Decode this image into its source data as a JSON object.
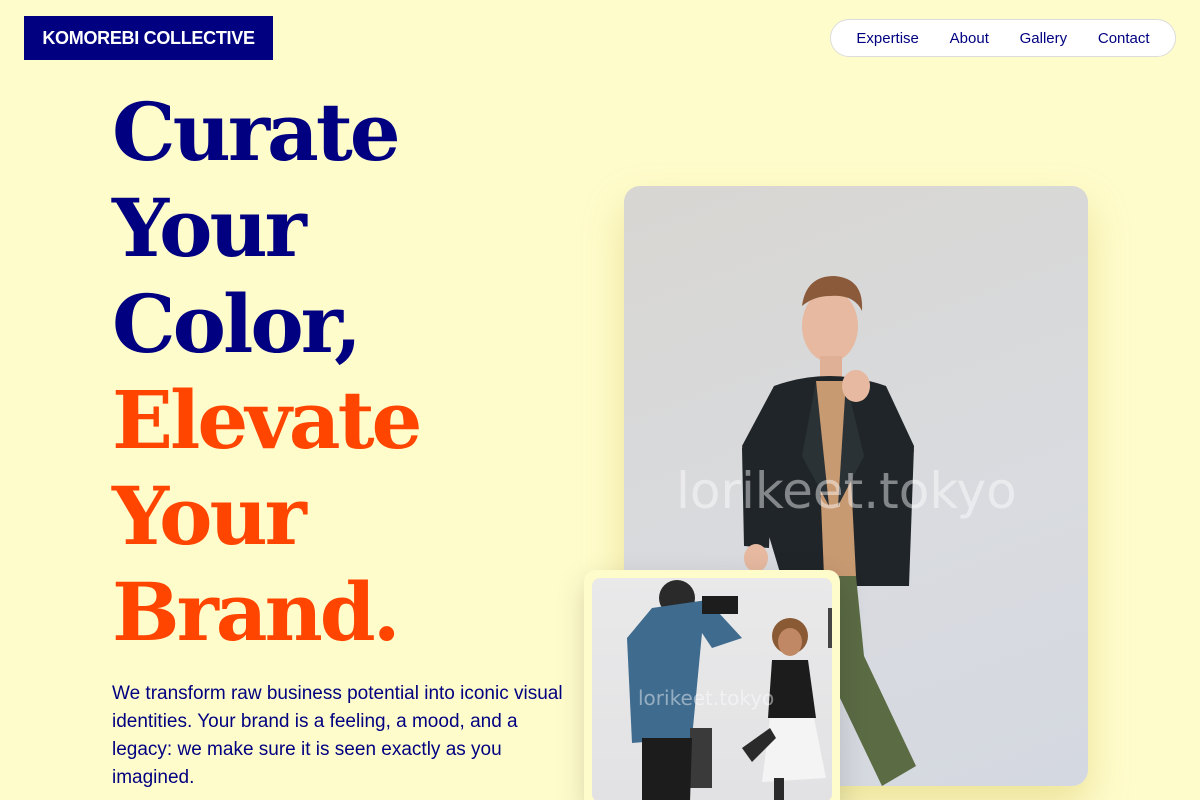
{
  "brand": {
    "name": "KOMOREBI COLLECTIVE"
  },
  "nav": {
    "items": [
      {
        "label": "Expertise"
      },
      {
        "label": "About"
      },
      {
        "label": "Gallery"
      },
      {
        "label": "Contact"
      }
    ]
  },
  "hero": {
    "headline_lines": [
      "Curate",
      "Your",
      "Color,",
      "Elevate",
      "Your",
      "Brand."
    ],
    "tagline": "We transform raw business potential into iconic visual identities. Your brand is a feeling, a mood, and a legacy: we make sure it is seen exactly as you imagined."
  },
  "images": {
    "main_watermark": "lorikeet.tokyo",
    "small_watermark": "lorikeet.tokyo"
  },
  "colors": {
    "background": "#fffccc",
    "navy": "#000080",
    "accent": "#ff4500"
  }
}
